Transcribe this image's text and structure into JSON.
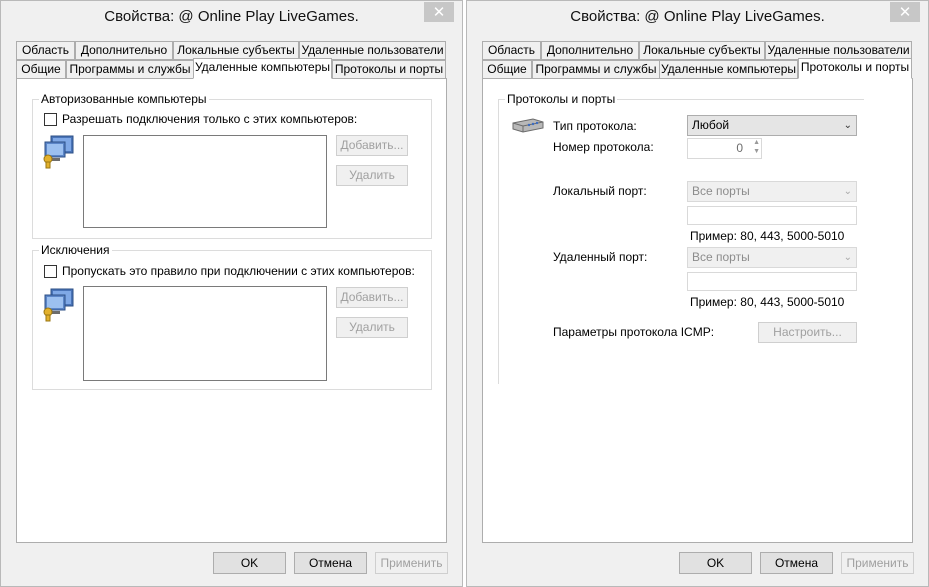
{
  "left_dialog": {
    "title": "Свойства: @ Online Play LiveGames.",
    "close_glyph": "✕",
    "tabs_row1": [
      "Область",
      "Дополнительно",
      "Локальные субъекты",
      "Удаленные пользователи"
    ],
    "tabs_row2": [
      "Общие",
      "Программы и службы",
      "Удаленные компьютеры",
      "Протоколы и порты"
    ],
    "active_tab": "Удаленные компьютеры",
    "authorized": {
      "group_label": "Авторизованные компьютеры",
      "checkbox_label": "Разрешать подключения только с этих компьютеров:",
      "checked": false,
      "add_button": "Добавить...",
      "remove_button": "Удалить"
    },
    "exceptions": {
      "group_label": "Исключения",
      "checkbox_label": "Пропускать это правило при подключении с этих компьютеров:",
      "checked": false,
      "add_button": "Добавить...",
      "remove_button": "Удалить"
    },
    "buttons": {
      "ok": "OK",
      "cancel": "Отмена",
      "apply": "Применить"
    }
  },
  "right_dialog": {
    "title": "Свойства: @ Online Play LiveGames.",
    "close_glyph": "✕",
    "tabs_row1": [
      "Область",
      "Дополнительно",
      "Локальные субъекты",
      "Удаленные пользователи"
    ],
    "tabs_row2": [
      "Общие",
      "Программы и службы",
      "Удаленные компьютеры",
      "Протоколы и порты"
    ],
    "active_tab": "Протоколы и порты",
    "protocols": {
      "group_label": "Протоколы и порты",
      "protocol_type_label": "Тип протокола:",
      "protocol_type_value": "Любой",
      "protocol_number_label": "Номер протокола:",
      "protocol_number_value": "0",
      "local_port_label": "Локальный порт:",
      "local_port_value": "Все порты",
      "local_port_example": "Пример: 80, 443, 5000-5010",
      "remote_port_label": "Удаленный порт:",
      "remote_port_value": "Все порты",
      "remote_port_example": "Пример: 80, 443, 5000-5010",
      "icmp_label": "Параметры протокола ICMP:",
      "configure_button": "Настроить..."
    },
    "buttons": {
      "ok": "OK",
      "cancel": "Отмена",
      "apply": "Применить"
    }
  },
  "colors": {
    "dialog_bg": "#f0f0f0",
    "panel_bg": "#ffffff",
    "close_button_bg": "#c7c7c7",
    "disabled_text": "#a0a0a0"
  }
}
